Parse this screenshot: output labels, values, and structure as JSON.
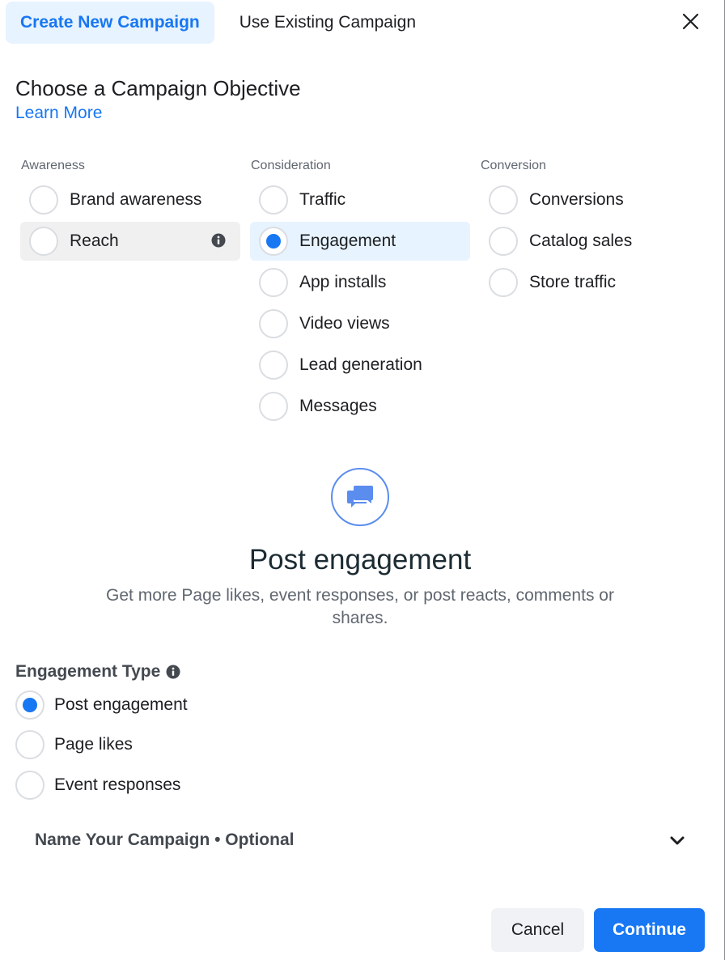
{
  "tabs": [
    {
      "label": "Create New Campaign",
      "active": true
    },
    {
      "label": "Use Existing Campaign",
      "active": false
    }
  ],
  "header": {
    "title": "Choose a Campaign Objective",
    "learn_more": "Learn More",
    "close_icon": "close-icon"
  },
  "objectives": {
    "columns": [
      {
        "heading": "Awareness",
        "options": [
          {
            "label": "Brand awareness",
            "selected": false
          },
          {
            "label": "Reach",
            "selected": false,
            "hovered": true,
            "info_icon": true
          }
        ]
      },
      {
        "heading": "Consideration",
        "options": [
          {
            "label": "Traffic",
            "selected": false
          },
          {
            "label": "Engagement",
            "selected": true
          },
          {
            "label": "App installs",
            "selected": false
          },
          {
            "label": "Video views",
            "selected": false
          },
          {
            "label": "Lead generation",
            "selected": false
          },
          {
            "label": "Messages",
            "selected": false
          }
        ]
      },
      {
        "heading": "Conversion",
        "options": [
          {
            "label": "Conversions",
            "selected": false
          },
          {
            "label": "Catalog sales",
            "selected": false
          },
          {
            "label": "Store traffic",
            "selected": false
          }
        ]
      }
    ]
  },
  "detail": {
    "icon": "chat-bubbles-icon",
    "title": "Post engagement",
    "description": "Get more Page likes, event responses, or post reacts, comments or shares."
  },
  "engagement_type": {
    "heading": "Engagement Type",
    "options": [
      {
        "label": "Post engagement",
        "selected": true
      },
      {
        "label": "Page likes",
        "selected": false
      },
      {
        "label": "Event responses",
        "selected": false
      }
    ]
  },
  "name_campaign": {
    "label": "Name Your Campaign • Optional",
    "expanded": false
  },
  "footer": {
    "cancel_label": "Cancel",
    "continue_label": "Continue"
  },
  "colors": {
    "accent": "#1877f2",
    "selected_bg": "#e7f3ff",
    "hover_bg": "#f0f0f0",
    "text": "#1c1e21",
    "muted": "#606770"
  }
}
